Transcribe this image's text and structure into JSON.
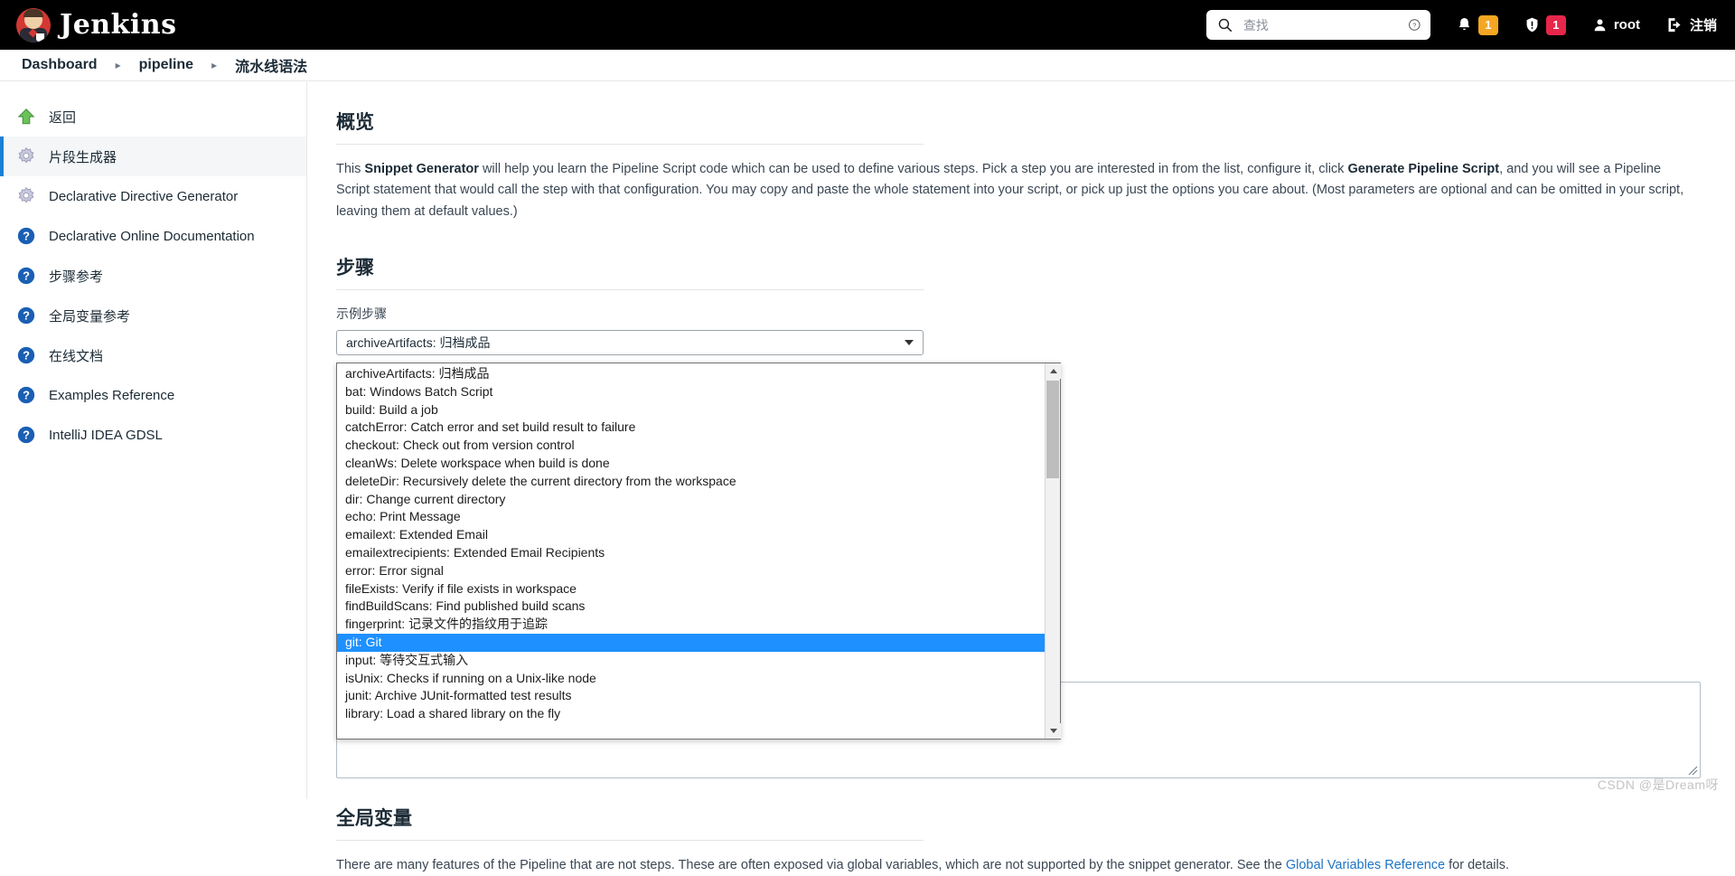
{
  "header": {
    "brand": "Jenkins",
    "logo_icon": "jenkins-butler-logo",
    "search": {
      "icon": "search-icon",
      "placeholder": "查找",
      "value": "",
      "help_icon": "help-circle-icon"
    },
    "notifications": {
      "icon": "bell-icon",
      "count": "1",
      "color": "#f5a623"
    },
    "alerts": {
      "icon": "shield-warning-icon",
      "count": "1",
      "color": "#e6264a"
    },
    "user": {
      "icon": "user-icon",
      "label": "root"
    },
    "logout": {
      "icon": "logout-icon",
      "label": "注销"
    }
  },
  "breadcrumb": {
    "items": [
      {
        "label": "Dashboard"
      },
      {
        "label": "pipeline"
      },
      {
        "label": "流水线语法"
      }
    ],
    "separator": "▸"
  },
  "sidebar": {
    "items": [
      {
        "label": "返回",
        "icon": "up-arrow-green-icon",
        "active": false
      },
      {
        "label": "片段生成器",
        "icon": "gear-icon",
        "active": true
      },
      {
        "label": "Declarative Directive Generator",
        "icon": "gear-icon",
        "active": false
      },
      {
        "label": "Declarative Online Documentation",
        "icon": "help-icon",
        "active": false
      },
      {
        "label": "步骤参考",
        "icon": "help-icon",
        "active": false
      },
      {
        "label": "全局变量参考",
        "icon": "help-icon",
        "active": false
      },
      {
        "label": "在线文档",
        "icon": "help-icon",
        "active": false
      },
      {
        "label": "Examples Reference",
        "icon": "help-icon",
        "active": false
      },
      {
        "label": "IntelliJ IDEA GDSL",
        "icon": "help-icon",
        "active": false
      }
    ]
  },
  "overview": {
    "title": "概览",
    "text_part1": "This ",
    "bold1": "Snippet Generator",
    "text_part2": " will help you learn the Pipeline Script code which can be used to define various steps. Pick a step you are interested in from the list, configure it, click ",
    "bold2": "Generate Pipeline Script",
    "text_part3": ", and you will see a Pipeline Script statement that would call the step with that configuration. You may copy and paste the whole statement into your script, or pick up just the options you care about. (Most parameters are optional and can be omitted in your script, leaving them at default values.)"
  },
  "steps": {
    "title": "步骤",
    "sample_step_label": "示例步骤",
    "selected_value": "archiveArtifacts: 归档成品",
    "caret_icon": "chevron-down-icon",
    "dropdown_open": true,
    "options": [
      "archiveArtifacts: 归档成品",
      "bat: Windows Batch Script",
      "build: Build a job",
      "catchError: Catch error and set build result to failure",
      "checkout: Check out from version control",
      "cleanWs: Delete workspace when build is done",
      "deleteDir: Recursively delete the current directory from the workspace",
      "dir: Change current directory",
      "echo: Print Message",
      "emailext: Extended Email",
      "emailextrecipients: Extended Email Recipients",
      "error: Error signal",
      "fileExists: Verify if file exists in workspace",
      "findBuildScans: Find published build scans",
      "fingerprint: 记录文件的指纹用于追踪",
      "git: Git",
      "input: 等待交互式输入",
      "isUnix: Checks if running on a Unix-like node",
      "junit: Archive JUnit-formatted test results",
      "library: Load a shared library on the fly"
    ],
    "highlighted_option": "git: Git",
    "highlight_color": "#1e90ff",
    "scrollbar": {
      "up_icon": "scroll-up-arrow-icon",
      "down_icon": "scroll-down-arrow-icon"
    }
  },
  "result": {
    "textarea_value": "",
    "resize_icon": "resize-grip-icon"
  },
  "globals": {
    "title": "全局变量",
    "text_part1": "There are many features of the Pipeline that are not steps. These are often exposed via global variables, which are not supported by the snippet generator. See the ",
    "link_label": "Global Variables Reference",
    "text_part2": " for details."
  },
  "watermark": "CSDN @是Dream呀"
}
